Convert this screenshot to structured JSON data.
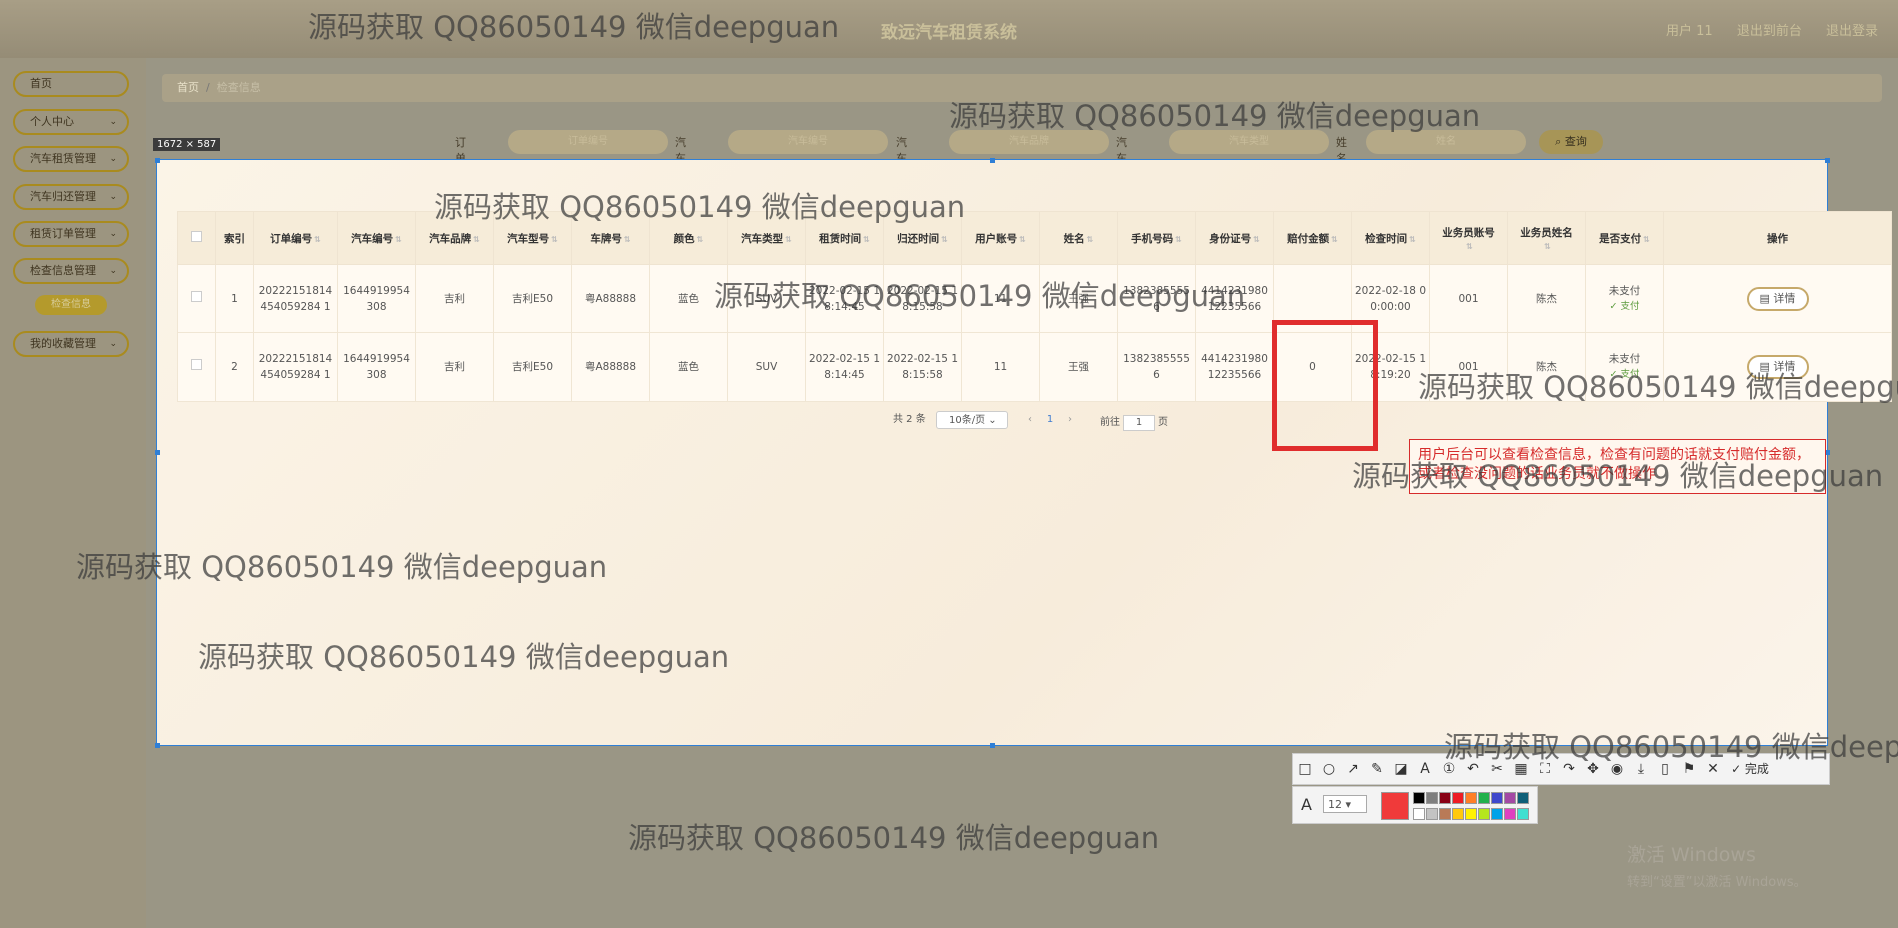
{
  "header": {
    "title": "致远汽车租赁系统",
    "user": "用户 11",
    "back_to_front": "退出到前台",
    "logout": "退出登录"
  },
  "sidebar": {
    "items": [
      {
        "label": "首页",
        "chev": ""
      },
      {
        "label": "个人中心",
        "chev": "⌄"
      },
      {
        "label": "汽车租赁管理",
        "chev": "⌄"
      },
      {
        "label": "汽车归还管理",
        "chev": "⌄"
      },
      {
        "label": "租赁订单管理",
        "chev": "⌄"
      },
      {
        "label": "检查信息管理",
        "chev": "⌄"
      },
      {
        "label": "我的收藏管理",
        "chev": "⌄"
      }
    ],
    "active_sub": "检查信息"
  },
  "breadcrumb": {
    "home": "首页",
    "sep": "/",
    "current": "检查信息"
  },
  "search": {
    "fields": [
      {
        "label": "订单编号",
        "placeholder": "订单编号"
      },
      {
        "label": "汽车编号",
        "placeholder": "汽车编号"
      },
      {
        "label": "汽车品牌",
        "placeholder": "汽车品牌"
      },
      {
        "label": "汽车类型",
        "placeholder": "汽车类型"
      },
      {
        "label": "姓名",
        "placeholder": "姓名"
      }
    ],
    "button": "⌕ 查询"
  },
  "selection": {
    "size_label": "1672 × 587"
  },
  "table": {
    "headers": [
      "",
      "索引",
      "订单编号",
      "汽车编号",
      "汽车品牌",
      "汽车型号",
      "车牌号",
      "颜色",
      "汽车类型",
      "租赁时间",
      "归还时间",
      "用户账号",
      "姓名",
      "手机号码",
      "身份证号",
      "赔付金额",
      "检查时间",
      "业务员账号",
      "业务员姓名",
      "是否支付",
      "操作"
    ],
    "rows": [
      {
        "index": "1",
        "order_no": "20222151814454059284 1",
        "car_no": "1644919954308",
        "brand": "吉利",
        "model": "吉利E50",
        "plate": "粤A88888",
        "color": "蓝色",
        "type": "SUV",
        "rent_time": "2022-02-15 18:14:45",
        "return_time": "2022-02-15 18:15:58",
        "account": "11",
        "name": "王强",
        "phone": "13823855556",
        "id_no": "441423198012235566",
        "compensation": "",
        "check_time": "2022-02-18 00:00:00",
        "clerk_account": "001",
        "clerk_name": "陈杰",
        "paid": "未支付",
        "pay_action": "✓ 支付",
        "op": "▤ 详情"
      },
      {
        "index": "2",
        "order_no": "20222151814454059284 1",
        "car_no": "1644919954308",
        "brand": "吉利",
        "model": "吉利E50",
        "plate": "粤A88888",
        "color": "蓝色",
        "type": "SUV",
        "rent_time": "2022-02-15 18:14:45",
        "return_time": "2022-02-15 18:15:58",
        "account": "11",
        "name": "王强",
        "phone": "13823855556",
        "id_no": "441423198012235566",
        "compensation": "0",
        "check_time": "2022-02-15 18:19:20",
        "clerk_account": "001",
        "clerk_name": "陈杰",
        "paid": "未支付",
        "pay_action": "✓ 支付",
        "op": "▤ 详情"
      }
    ]
  },
  "pagination": {
    "total": "共 2 条",
    "page_size": "10条/页",
    "prev": "‹",
    "current_page": "1",
    "next": "›",
    "goto_prefix": "前往",
    "goto_value": "1",
    "goto_suffix": "页"
  },
  "annotation": {
    "note": "用户后台可以查看检查信息，检查有问题的话就支付赔付金额，或者检查没问题的话业务员就不做操作"
  },
  "toolbar": {
    "tools": [
      "□",
      "○",
      "↗",
      "✎",
      "◪",
      "A",
      "①",
      "↶",
      "✂",
      "▦",
      "⛶",
      "↷",
      "✥",
      "◉",
      "⤓",
      "▯",
      "⚑",
      "✕"
    ],
    "done": "✓ 完成",
    "font_icon": "A",
    "font_size": "12 ▾",
    "current_color": "#f03a3a",
    "palette": [
      "#000000",
      "#7f7f7f",
      "#880015",
      "#ed1c24",
      "#ff7f27",
      "#22b14c",
      "#3f48cc",
      "#a349a4",
      "#0f5f78",
      "#ffffff",
      "#c3c3c3",
      "#b97a57",
      "#ffc90e",
      "#fff200",
      "#b5e61d",
      "#00a2e8",
      "#e040c0",
      "#40e0d0"
    ]
  },
  "windows": {
    "line1": "激活 Windows",
    "line2": "转到“设置”以激活 Windows。"
  },
  "watermark": "源码获取 QQ86050149 微信deepguan"
}
